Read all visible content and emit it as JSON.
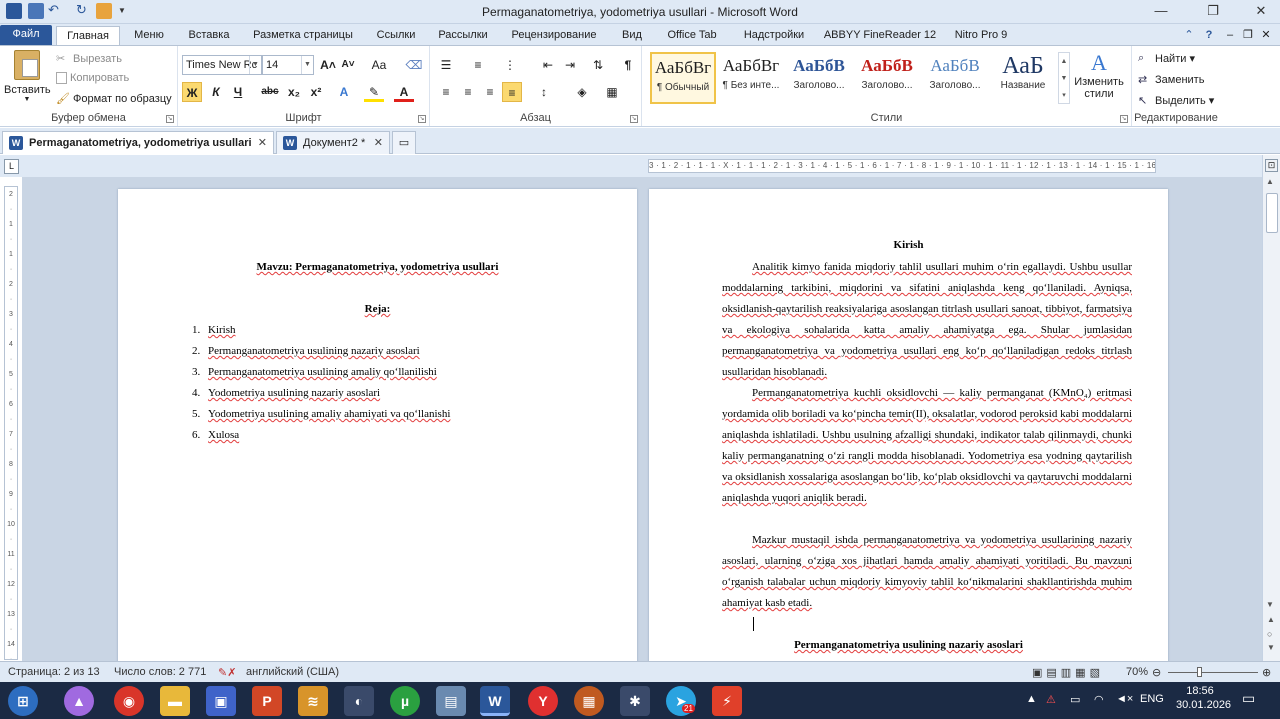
{
  "window": {
    "title": "Permaganatometriya, yodometriya usullari  -  Microsoft Word"
  },
  "ribbon_tabs": [
    "Файл",
    "Главная",
    "Меню",
    "Вставка",
    "Разметка страницы",
    "Ссылки",
    "Рассылки",
    "Рецензирование",
    "Вид",
    "Office Tab",
    "Надстройки",
    "ABBYY FineReader 12",
    "Nitro Pro 9"
  ],
  "clipboard": {
    "paste": "Вставить",
    "cut": "Вырезать",
    "copy": "Копировать",
    "format_painter": "Формат по образцу",
    "label": "Буфер обмена"
  },
  "font": {
    "name": "Times New Rc",
    "size": "14",
    "label": "Шрифт",
    "grow": "A˄",
    "shrink": "A˅",
    "case": "Aa",
    "bold": "Ж",
    "italic": "К",
    "underline": "Ч",
    "strike": "abc",
    "sub": "x₂",
    "sup": "x²"
  },
  "paragraph": {
    "label": "Абзац"
  },
  "styles": {
    "label": "Стили",
    "items": [
      {
        "preview": "АаБбВг",
        "name": "¶ Обычный"
      },
      {
        "preview": "АаБбВг",
        "name": "¶ Без инте..."
      },
      {
        "preview": "АаБбВ",
        "name": "Заголово..."
      },
      {
        "preview": "АаБбВ",
        "name": "Заголово..."
      },
      {
        "preview": "АаБбВ",
        "name": "Заголово..."
      },
      {
        "preview": "АаБ",
        "name": "Название"
      }
    ],
    "change": "Изменить стили"
  },
  "editing": {
    "find": "Найти",
    "replace": "Заменить",
    "select": "Выделить",
    "label": "Редактирование"
  },
  "doc_tabs": [
    {
      "label": "Permaganatometriya, yodometriya usullari"
    },
    {
      "label": "Документ2 *"
    }
  ],
  "ruler_text": "3 · 1 · 2 · 1 · 1 · 1 · X · 1 · 1 · 1 · 2 · 1 · 3 · 1 · 4 · 1 · 5 · 1 · 6 · 1 · 7 · 1 · 8 · 1 · 9 · 1 · 10 · 1 · 11 · 1 · 12 · 1 · 13 · 1 · 14 · 1 · 15 · 1 · 16 · 1 · 17 · 1",
  "page1": {
    "topic": "Mavzu: Permaganatometriya, yodometriya usullari",
    "plan_title": "Reja:",
    "plan": [
      {
        "n": "1.",
        "t": "Kirish"
      },
      {
        "n": "2.",
        "t": "Permanganatometriya usulining nazariy asoslari"
      },
      {
        "n": "3.",
        "t": "Permanganatometriya usulining amaliy qo‘llanilishi"
      },
      {
        "n": "4.",
        "t": "Yodometriya usulining nazariy asoslari"
      },
      {
        "n": "5.",
        "t": "Yodometriya usulining amaliy ahamiyati va qo‘llanishi"
      },
      {
        "n": "6.",
        "t": "Xulosa"
      }
    ]
  },
  "page2": {
    "heading": "Kirish",
    "p1": "Analitik kimyo fanida miqdoriy tahlil usullari muhim o‘rin egallaydi. Ushbu usullar moddalarning tarkibini, miqdorini va sifatini aniqlashda keng qo‘llaniladi. Ayniqsa, oksidlanish-qaytarilish reaksiyalariga asoslangan titrlash usullari sanoat, tibbiyot, farmatsiya va ekologiya sohalarida katta amaliy ahamiyatga ega. Shular jumlasidan permanganatometriya va yodometriya usullari eng ko‘p qo‘llaniladigan redoks titrlash usullaridan hisoblanadi.",
    "p2": "Permanganatometriya kuchli oksidlovchi — kaliy permanganat (KMnO₄) eritmasi yordamida olib boriladi va ko‘pincha temir(II), oksalatlar, vodorod peroksid kabi moddalarni aniqlashda ishlatiladi. Ushbu usulning afzalligi shundaki, indikator talab qilinmaydi, chunki kaliy permanganatning o‘zi rangli modda hisoblanadi. Yodometriya esa yodning qaytarilish va oksidlanish xossalariga asoslangan bo‘lib, ko‘plab oksidlovchi va qaytaruvchi moddalarni aniqlashda yuqori aniqlik beradi.",
    "p3": "Mazkur mustaqil ishda permanganatometriya va yodometriya usullarining nazariy asoslari, ularning o‘ziga xos jihatlari hamda amaliy ahamiyati yoritiladi. Bu mavzuni o‘rganish talabalar uchun miqdoriy kimyoviy tahlil ko‘nikmalarini shakllantirishda muhim ahamiyat kasb etadi.",
    "next_heading": "Permanganatometriya usulining nazariy asoslari"
  },
  "status": {
    "page": "Страница: 2 из 13",
    "words": "Число слов: 2 771",
    "lang": "английский (США)",
    "zoom": "70%"
  },
  "taskbar": {
    "lang": "ENG",
    "time": "18:56",
    "date": "30.01.2026",
    "badge": "21"
  }
}
